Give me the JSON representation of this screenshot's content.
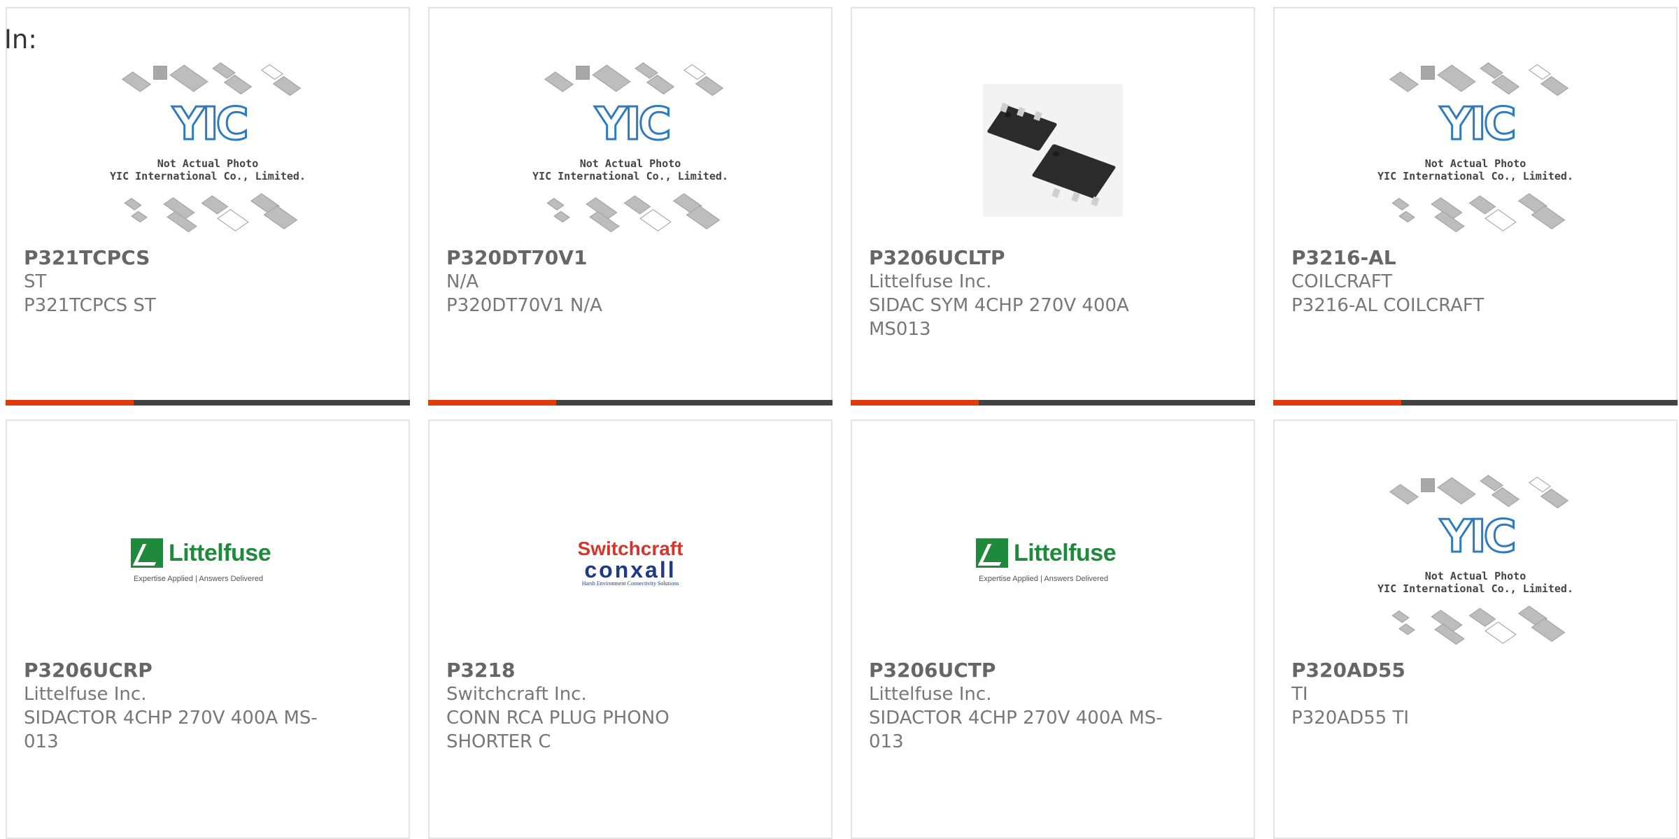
{
  "header": {
    "in_label": "In:"
  },
  "placeholder_image": {
    "line1": "Not Actual Photo",
    "line2": "YIC International Co., Limited.",
    "logo": "YIC"
  },
  "logos": {
    "littelfuse": {
      "name": "Littelfuse",
      "tagline": "Expertise Applied | Answers Delivered"
    },
    "switchcraft": {
      "top": "Switchcraft",
      "mid": "conxall",
      "bot": "Harsh Environment Connectivity Solutions"
    }
  },
  "products": [
    {
      "part": "P321TCPCS",
      "manufacturer": "ST",
      "description": "P321TCPCS ST",
      "image": "placeholder"
    },
    {
      "part": "P320DT70V1",
      "manufacturer": "N/A",
      "description": "P320DT70V1 N/A",
      "image": "placeholder"
    },
    {
      "part": "P3206UCLTP",
      "manufacturer": "Littelfuse Inc.",
      "description": "SIDAC SYM 4CHP 270V 400A MS013",
      "image": "photo"
    },
    {
      "part": "P3216-AL",
      "manufacturer": "COILCRAFT",
      "description": "P3216-AL COILCRAFT",
      "image": "placeholder"
    },
    {
      "part": "P3206UCRP",
      "manufacturer": "Littelfuse Inc.",
      "description": "SIDACTOR 4CHP 270V 400A MS-013",
      "image": "littelfuse-logo"
    },
    {
      "part": "P3218",
      "manufacturer": "Switchcraft Inc.",
      "description": "CONN RCA PLUG PHONO SHORTER C",
      "image": "switchcraft-logo"
    },
    {
      "part": "P3206UCTP",
      "manufacturer": "Littelfuse Inc.",
      "description": "SIDACTOR 4CHP 270V 400A MS-013",
      "image": "littelfuse-logo"
    },
    {
      "part": "P320AD55",
      "manufacturer": "TI",
      "description": "P320AD55 TI",
      "image": "placeholder"
    }
  ],
  "colors": {
    "accent": "#e03a10",
    "bar": "#444444",
    "text": "#666666",
    "border": "#e3e3e3"
  }
}
